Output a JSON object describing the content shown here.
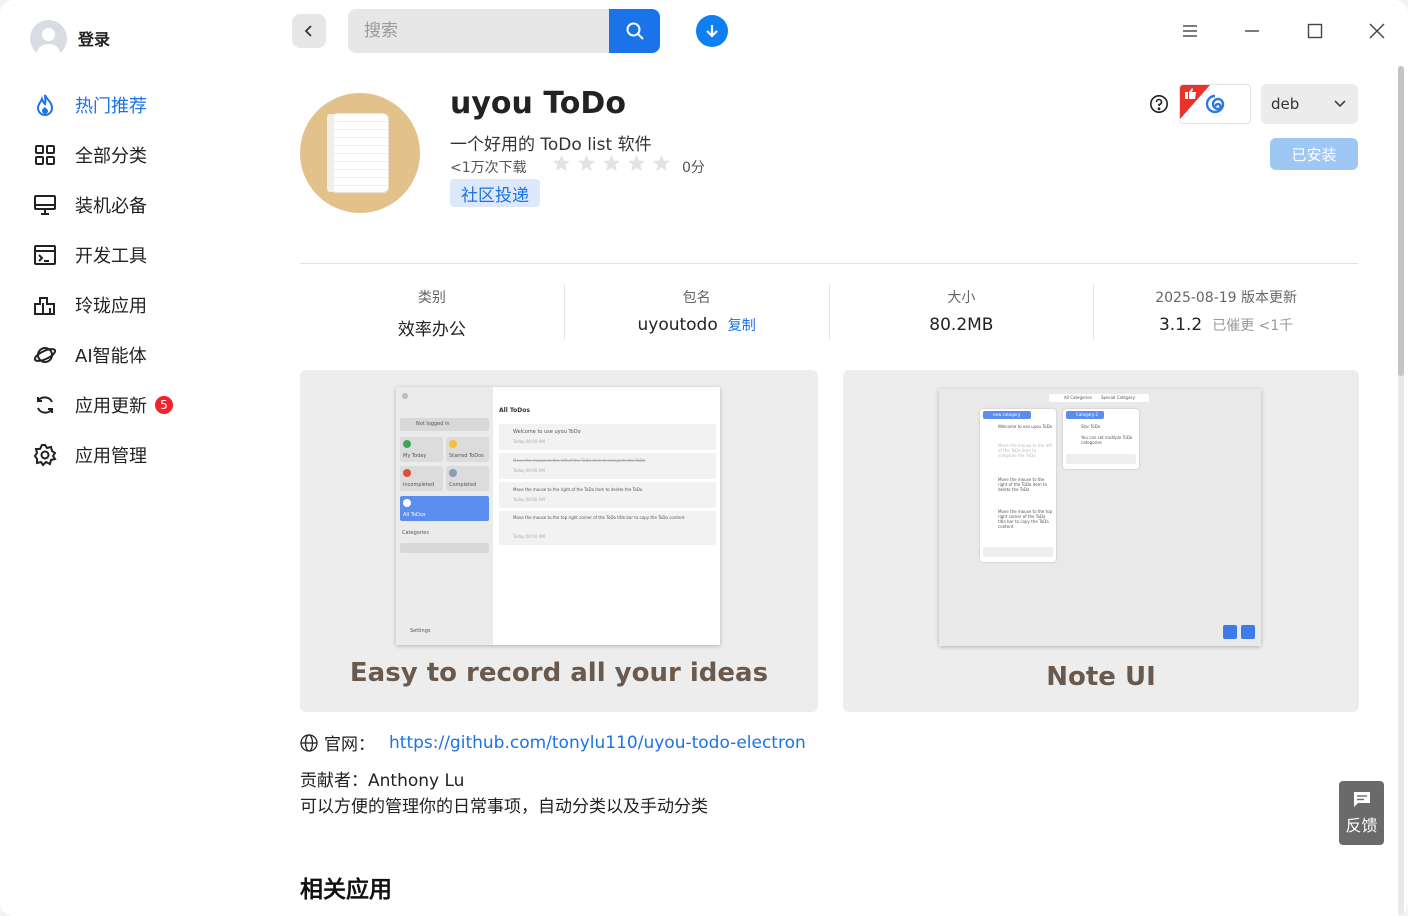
{
  "sidebar": {
    "user_label": "登录",
    "items": [
      {
        "label": "热门推荐",
        "icon": "flame-icon",
        "active": true
      },
      {
        "label": "全部分类",
        "icon": "grid-icon"
      },
      {
        "label": "装机必备",
        "icon": "monitor-icon"
      },
      {
        "label": "开发工具",
        "icon": "terminal-icon"
      },
      {
        "label": "玲珑应用",
        "icon": "building-icon"
      },
      {
        "label": "AI智能体",
        "icon": "planet-icon"
      },
      {
        "label": "应用更新",
        "icon": "refresh-icon",
        "badge": "5"
      },
      {
        "label": "应用管理",
        "icon": "gear-icon"
      }
    ]
  },
  "toolbar": {
    "search_placeholder": "搜索"
  },
  "app": {
    "name": "uyou ToDo",
    "subtitle": "一个好用的 ToDo list 软件",
    "downloads": "<1万次下载",
    "rating": 0,
    "score_label": "0分",
    "tag": "社区投递",
    "format": "deb",
    "install_label": "已安装"
  },
  "info": {
    "category_label": "类别",
    "category_value": "效率办公",
    "package_label": "包名",
    "package_value": "uyoutodo",
    "copy_label": "复制",
    "size_label": "大小",
    "size_value": "80.2MB",
    "update_label": "2025-08-19 版本更新",
    "version_value": "3.1.2",
    "urge_label": "已催更 <1千"
  },
  "screenshots": [
    {
      "caption": "Easy to record all your ideas",
      "ui": {
        "not_logged": "Not logged in",
        "my_today": "My Today",
        "starred": "Starred ToDos",
        "incompleted": "Incompleted",
        "completed": "Completed",
        "all_todos": "All ToDos",
        "categories": "Categories",
        "settings": "Settings",
        "header": "All ToDos",
        "todos": [
          "Welcome to use uyou ToDo",
          "Move the mouse to the left of the ToDo item to complete the ToDo",
          "Move the mouse to the right of the ToDo item to delete the ToDo",
          "Move the mouse to the top right corner of the ToDo title bar to copy the ToDo content"
        ],
        "time": "Today 00:00 AM"
      }
    },
    {
      "caption": "Note UI",
      "ui": {
        "tab1": "All Categories",
        "tab2": "Special Category",
        "col1_title": "new category",
        "col1_items": [
          "Welcome to use uyou ToDo",
          "Move the mouse to the left of the ToDo item to complete the ToDo",
          "Move the mouse to the right of the ToDo item to delete the ToDo",
          "Move the mouse to the top right corner of the ToDo title bar to copy the ToDo content"
        ],
        "col2_title": "Category 2",
        "col2_items": [
          "Star ToDo",
          "You can set multiple ToDo categories"
        ]
      }
    }
  ],
  "details": {
    "site_label": "官网：",
    "site_url": "https://github.com/tonylu110/uyou-todo-electron",
    "contributor": "贡献者：Anthony Lu",
    "description": "可以方便的管理你的日常事项，自动分类以及手动分类",
    "related_title": "相关应用"
  },
  "feedback_label": "反馈",
  "colors": {
    "accent": "#1a73e8",
    "icon_bg": "#e2c18a",
    "badge": "#f5222d"
  }
}
